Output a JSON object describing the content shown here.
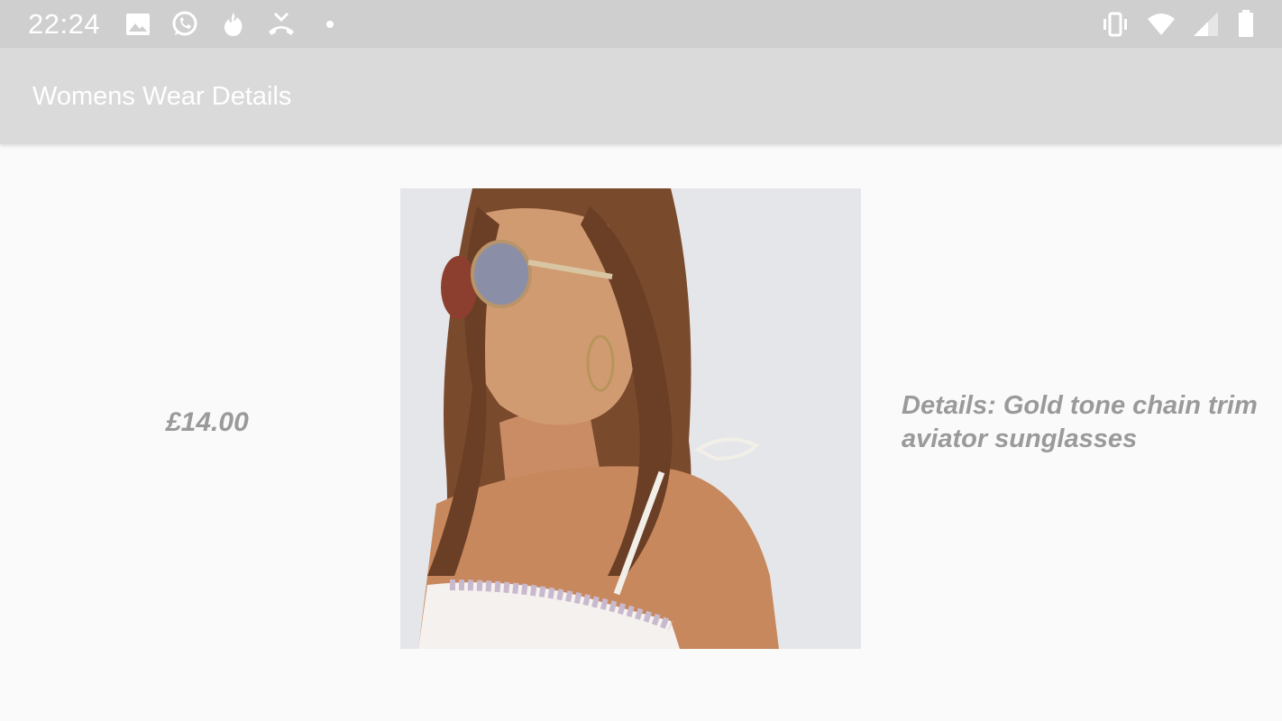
{
  "status_bar": {
    "time": "22:24",
    "left_icons": [
      "image-icon",
      "whatsapp-icon",
      "tinder-icon",
      "missed-call-icon",
      "dot-icon"
    ],
    "right_icons": [
      "vibrate-icon",
      "wifi-icon",
      "signal-icon",
      "battery-icon"
    ]
  },
  "app_bar": {
    "title": "Womens Wear Details"
  },
  "product": {
    "price": "£14.00",
    "details": "Details: Gold tone chain trim aviator sunglasses",
    "image": "model-wearing-aviator-sunglasses"
  },
  "colors": {
    "status_bar_bg": "#cfcfcf",
    "app_bar_bg": "#dadada",
    "page_bg": "#fafafa",
    "text_gray": "#9a9a9a"
  }
}
